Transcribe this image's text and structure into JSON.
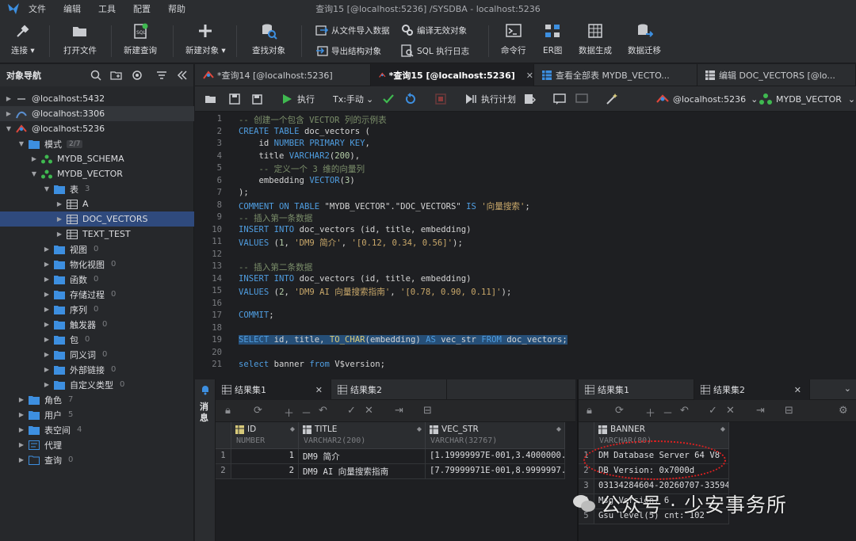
{
  "window_title": "查询15 [@localhost:5236] /SYSDBA  - localhost:5236",
  "menu": [
    "文件",
    "编辑",
    "工具",
    "配置",
    "帮助"
  ],
  "toolbar": {
    "connect": "连接",
    "open_file": "打开文件",
    "new_query": "新建查询",
    "new_object": "新建对象",
    "find_object": "查找对象",
    "import_data": "从文件导入数据",
    "export_struct": "导出结构对象",
    "compile_invalid": "编译无效对象",
    "sql_log": "SQL 执行日志",
    "cmd": "命令行",
    "er": "ER图",
    "data_gen": "数据生成",
    "data_migrate": "数据迁移"
  },
  "nav": {
    "title": "对象导航",
    "items": [
      {
        "label": "@localhost:5432"
      },
      {
        "label": "@localhost:3306"
      },
      {
        "label": "@localhost:5236"
      },
      {
        "label": "模式",
        "badge": "2/7"
      },
      {
        "label": "MYDB_SCHEMA"
      },
      {
        "label": "MYDB_VECTOR"
      },
      {
        "label": "表",
        "count": "3"
      },
      {
        "label": "A"
      },
      {
        "label": "DOC_VECTORS"
      },
      {
        "label": "TEXT_TEST"
      },
      {
        "label": "视图",
        "count": "0"
      },
      {
        "label": "物化视图",
        "count": "0"
      },
      {
        "label": "函数",
        "count": "0"
      },
      {
        "label": "存储过程",
        "count": "0"
      },
      {
        "label": "序列",
        "count": "0"
      },
      {
        "label": "触发器",
        "count": "0"
      },
      {
        "label": "包",
        "count": "0"
      },
      {
        "label": "同义词",
        "count": "0"
      },
      {
        "label": "外部链接",
        "count": "0"
      },
      {
        "label": "自定义类型",
        "count": "0"
      },
      {
        "label": "角色",
        "count": "7"
      },
      {
        "label": "用户",
        "count": "5"
      },
      {
        "label": "表空间",
        "count": "4"
      },
      {
        "label": "代理"
      },
      {
        "label": "查询",
        "count": "0"
      }
    ]
  },
  "tabs": [
    {
      "label": "*查询14 [@localhost:5236]"
    },
    {
      "label": "*查询15 [@localhost:5236]",
      "close": "✕"
    },
    {
      "label": "查看全部表 MYDB_VECTO..."
    },
    {
      "label": "编辑 DOC_VECTORS [@lo..."
    }
  ],
  "editor_toolbar": {
    "run": "执行",
    "tx": "Tx:手动",
    "plan": "执行计划",
    "conn": "@localhost:5236",
    "schema": "MYDB_VECTOR"
  },
  "code": [
    {
      "n": "1",
      "t": "-- 创建一个包含 VECTOR 列的示例表"
    },
    {
      "n": "2",
      "t": "CREATE TABLE doc_vectors ("
    },
    {
      "n": "3",
      "t": "    id NUMBER PRIMARY KEY,"
    },
    {
      "n": "4",
      "t": "    title VARCHAR2(200),"
    },
    {
      "n": "5",
      "t": "    -- 定义一个 3 维的向量列"
    },
    {
      "n": "6",
      "t": "    embedding VECTOR(3)"
    },
    {
      "n": "7",
      "t": ");"
    },
    {
      "n": "8",
      "t": "COMMENT ON TABLE \"MYDB_VECTOR\".\"DOC_VECTORS\" IS '向量搜索';"
    },
    {
      "n": "9",
      "t": "-- 插入第一条数据"
    },
    {
      "n": "10",
      "t": "INSERT INTO doc_vectors (id, title, embedding)"
    },
    {
      "n": "11",
      "t": "VALUES (1, 'DM9 简介', '[0.12, 0.34, 0.56]');"
    },
    {
      "n": "12",
      "t": ""
    },
    {
      "n": "13",
      "t": "-- 插入第二条数据"
    },
    {
      "n": "14",
      "t": "INSERT INTO doc_vectors (id, title, embedding)"
    },
    {
      "n": "15",
      "t": "VALUES (2, 'DM9 AI 向量搜索指南', '[0.78, 0.90, 0.11]');"
    },
    {
      "n": "16",
      "t": ""
    },
    {
      "n": "17",
      "t": "COMMIT;"
    },
    {
      "n": "18",
      "t": ""
    },
    {
      "n": "19",
      "t": "SELECT id, title, TO_CHAR(embedding) AS vec_str FROM doc_vectors;"
    },
    {
      "n": "20",
      "t": ""
    },
    {
      "n": "21",
      "t": "select banner from V$version;"
    }
  ],
  "messages_label": "消息",
  "res1": {
    "tabs": [
      "结果集1",
      "结果集2"
    ],
    "close": "✕",
    "columns": [
      {
        "name": "ID",
        "type": "NUMBER"
      },
      {
        "name": "TITLE",
        "type": "VARCHAR2(200)"
      },
      {
        "name": "VEC_STR",
        "type": "VARCHAR(32767)"
      }
    ],
    "rows": [
      [
        "1",
        "1",
        "DM9 简介",
        "[1.19999997E-001,3.4000000..."
      ],
      [
        "2",
        "2",
        "DM9 AI 向量搜索指南",
        "[7.79999971E-001,8.9999997..."
      ]
    ]
  },
  "res2": {
    "tabs": [
      "结果集1",
      "结果集2"
    ],
    "close": "✕",
    "columns": [
      {
        "name": "BANNER",
        "type": "VARCHAR(80)"
      }
    ],
    "rows": [
      [
        "1",
        "DM Database Server 64 V8"
      ],
      [
        "2",
        "DB Version: 0x7000d"
      ],
      [
        "3",
        "03134284604-20260707-33594..."
      ],
      [
        "4",
        "Msg Version: 6"
      ],
      [
        "5",
        "Gsu level(5) cnt: 102"
      ]
    ]
  },
  "watermark": "公众号 · 少安事务所"
}
